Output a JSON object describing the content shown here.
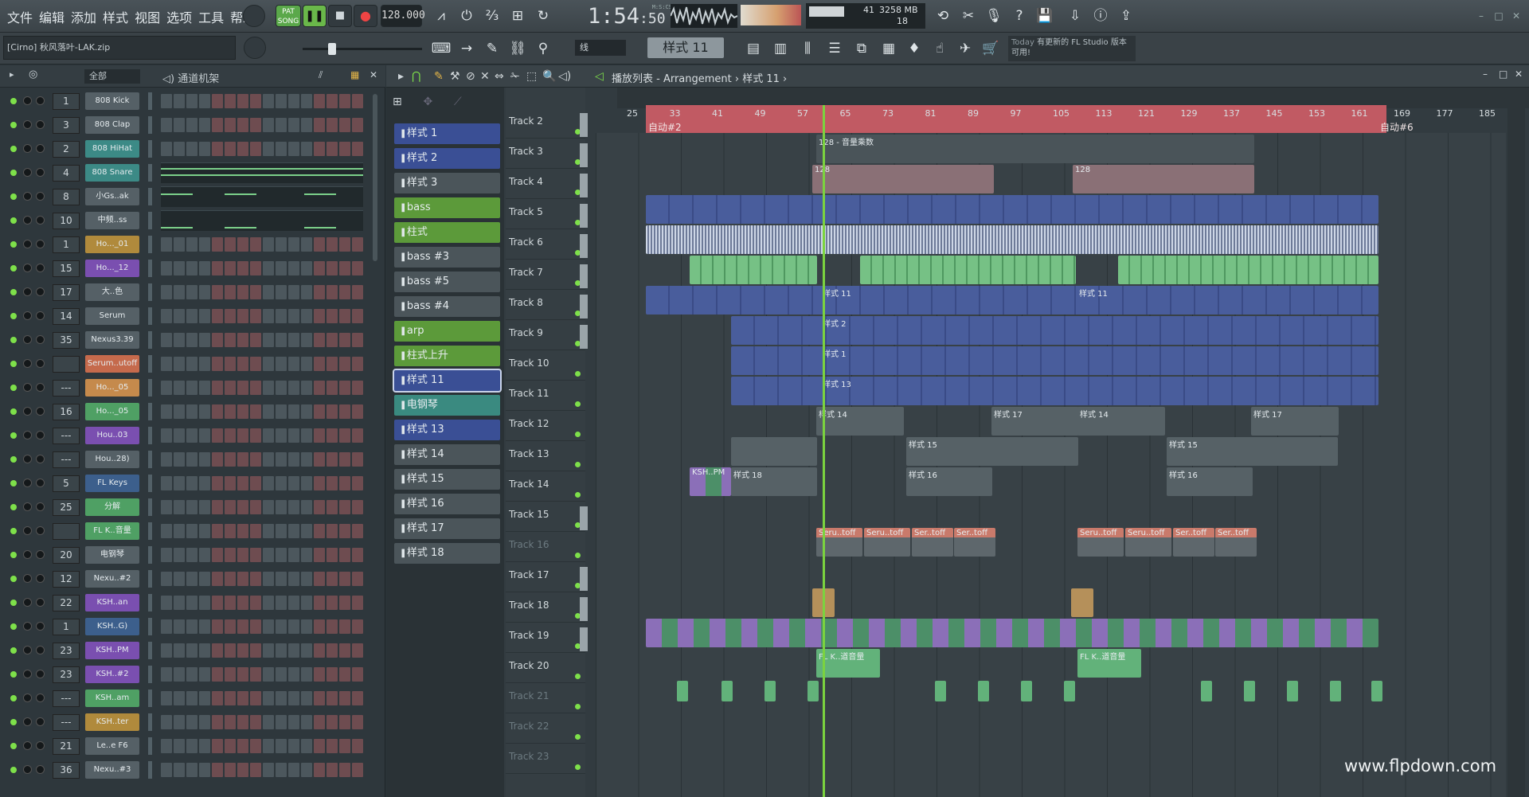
{
  "menu": [
    "文件",
    "编辑",
    "添加",
    "样式",
    "视图",
    "选项",
    "工具",
    "帮助"
  ],
  "transport": {
    "song_label": "SONG",
    "pat_label": "PAT",
    "tempo": "128.000",
    "time": "1:54",
    "time_sub": "50",
    "time_unit": "M:S:CS"
  },
  "cpu": {
    "cpu": "41",
    "memory": "3258 MB",
    "poly": "18"
  },
  "project": "[Cirno] 秋风落叶-LAK.zip",
  "pattern_selector": "样式 11",
  "snap": "线",
  "news": {
    "title": "Today",
    "text": "有更新的 FL Studio 版本可用!"
  },
  "rack": {
    "filter": "全部",
    "title": "通道机架",
    "channels": [
      {
        "num": "1",
        "name": "808 Kick",
        "color": "#556066"
      },
      {
        "num": "3",
        "name": "808 Clap",
        "color": "#556066"
      },
      {
        "num": "2",
        "name": "808 HiHat",
        "color": "#3c8a86"
      },
      {
        "num": "4",
        "name": "808 Snare",
        "color": "#3c8a86"
      },
      {
        "num": "8",
        "name": "小Gs..ak",
        "color": "#556066"
      },
      {
        "num": "10",
        "name": "中频..ss",
        "color": "#556066"
      },
      {
        "num": "1",
        "name": "Ho..._01",
        "color": "#b08a3c"
      },
      {
        "num": "15",
        "name": "Ho..._12",
        "color": "#7a4fb0"
      },
      {
        "num": "17",
        "name": "大..色",
        "color": "#556066"
      },
      {
        "num": "14",
        "name": "Serum",
        "color": "#556066"
      },
      {
        "num": "35",
        "name": "Nexus3.39",
        "color": "#556066"
      },
      {
        "num": "",
        "name": "Serum..utoff",
        "color": "#c56a4c"
      },
      {
        "num": "---",
        "name": "Ho..._05",
        "color": "#c58a4c"
      },
      {
        "num": "16",
        "name": "Ho..._05",
        "color": "#4fa064"
      },
      {
        "num": "---",
        "name": "Hou..03",
        "color": "#7a4fb0"
      },
      {
        "num": "---",
        "name": "Hou..28)",
        "color": "#556066"
      },
      {
        "num": "5",
        "name": "FL Keys",
        "color": "#3c5f8c"
      },
      {
        "num": "25",
        "name": "分解",
        "color": "#4fa064"
      },
      {
        "num": "",
        "name": "FL K..音量",
        "color": "#4fa064"
      },
      {
        "num": "20",
        "name": "电钢琴",
        "color": "#556066"
      },
      {
        "num": "12",
        "name": "Nexu..#2",
        "color": "#556066"
      },
      {
        "num": "22",
        "name": "KSH..an",
        "color": "#7a4fb0"
      },
      {
        "num": "1",
        "name": "KSH..G)",
        "color": "#3c5f8c"
      },
      {
        "num": "23",
        "name": "KSH..PM",
        "color": "#7a4fb0"
      },
      {
        "num": "23",
        "name": "KSH..#2",
        "color": "#7a4fb0"
      },
      {
        "num": "---",
        "name": "KSH..am",
        "color": "#4fa064"
      },
      {
        "num": "---",
        "name": "KSH..ter",
        "color": "#b08a3c"
      },
      {
        "num": "21",
        "name": "Le..e F6",
        "color": "#556066"
      },
      {
        "num": "36",
        "name": "Nexu..#3",
        "color": "#556066"
      }
    ]
  },
  "playlist": {
    "title": "播放列表 - Arrangement",
    "breadcrumb": "样式 11",
    "patterns": [
      {
        "name": "样式 1",
        "color": "#3a4f95"
      },
      {
        "name": "样式 2",
        "color": "#3a4f95"
      },
      {
        "name": "样式 3",
        "color": "#4b555a"
      },
      {
        "name": "bass",
        "color": "#5c9a3a"
      },
      {
        "name": "柱式",
        "color": "#5c9a3a"
      },
      {
        "name": "bass #3",
        "color": "#4b555a"
      },
      {
        "name": "bass #5",
        "color": "#4b555a"
      },
      {
        "name": "bass #4",
        "color": "#4b555a"
      },
      {
        "name": "arp",
        "color": "#5c9a3a"
      },
      {
        "name": "柱式上升",
        "color": "#5c9a3a"
      },
      {
        "name": "样式 11",
        "color": "#3a4f95"
      },
      {
        "name": "电钢琴",
        "color": "#3a8a80"
      },
      {
        "name": "样式 13",
        "color": "#3a4f95"
      },
      {
        "name": "样式 14",
        "color": "#4b555a"
      },
      {
        "name": "样式 15",
        "color": "#4b555a"
      },
      {
        "name": "样式 16",
        "color": "#4b555a"
      },
      {
        "name": "样式 17",
        "color": "#4b555a"
      },
      {
        "name": "样式 18",
        "color": "#4b555a"
      }
    ],
    "tracks": [
      "Track 2",
      "Track 3",
      "Track 4",
      "Track 5",
      "Track 6",
      "Track 7",
      "Track 8",
      "Track 9",
      "Track 10",
      "Track 11",
      "Track 12",
      "Track 13",
      "Track 14",
      "Track 15",
      "Track 16",
      "Track 17",
      "Track 18",
      "Track 19",
      "Track 20",
      "Track 21",
      "Track 22",
      "Track 23"
    ],
    "ruler": [
      "25",
      "33",
      "41",
      "49",
      "57",
      "65",
      "73",
      "81",
      "89",
      "97",
      "105",
      "113",
      "121",
      "129",
      "137",
      "145",
      "153",
      "161",
      "169",
      "177",
      "185"
    ],
    "automation_left": "自动#2",
    "automation_right": "自动#6",
    "clip_labels": {
      "t2": "128 - 音量乘数",
      "t3": "128",
      "t7": "样式 11",
      "t8": "样式 2",
      "t9": "样式 1",
      "t10": "样式 13",
      "t11a": "样式 14",
      "t11b": "样式 17",
      "t12": "样式 15",
      "t13a": "KSH..PM",
      "t13b": "样式 18",
      "t13c": "样式 16",
      "t15a": "Seru..toff",
      "t15b": "Ser..toff",
      "t19": "FL K..道音量",
      "t11c": "样式 17"
    }
  },
  "watermark": "www.flpdown.com"
}
